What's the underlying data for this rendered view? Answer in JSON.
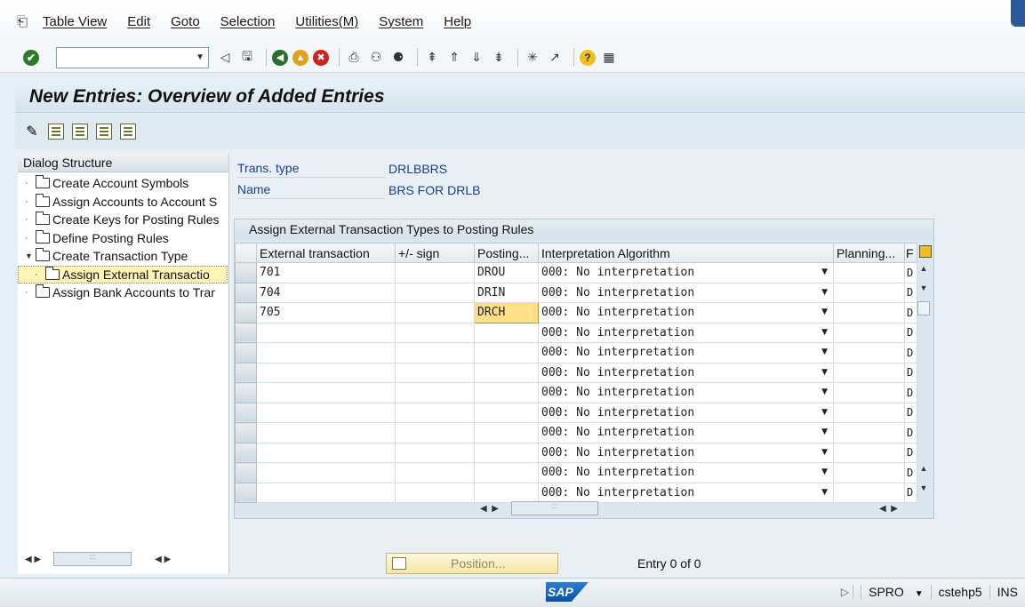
{
  "menubar": {
    "items": [
      "Table View",
      "Edit",
      "Goto",
      "Selection",
      "Utilities(M)",
      "System",
      "Help"
    ]
  },
  "toolbar": {
    "command_field_value": ""
  },
  "title": "New Entries: Overview of Added Entries",
  "dialog_structure": {
    "header": "Dialog Structure",
    "items": [
      {
        "label": "Create Account Symbols",
        "level": 0,
        "expanded": false
      },
      {
        "label": "Assign Accounts to Account S",
        "level": 0,
        "expanded": false
      },
      {
        "label": "Create Keys for Posting Rules",
        "level": 0,
        "expanded": false
      },
      {
        "label": "Define Posting Rules",
        "level": 0,
        "expanded": false
      },
      {
        "label": "Create Transaction Type",
        "level": 0,
        "expanded": true
      },
      {
        "label": "Assign External Transactio",
        "level": 1,
        "selected": true
      },
      {
        "label": "Assign Bank Accounts to Trar",
        "level": 0,
        "expanded": false
      }
    ]
  },
  "header_fields": [
    {
      "label": "Trans. type",
      "value": "DRLBBRS"
    },
    {
      "label": "Name",
      "value": "BRS FOR DRLB"
    }
  ],
  "table": {
    "title": "Assign External Transaction Types to Posting Rules",
    "columns": [
      "External transaction",
      "+/- sign",
      "Posting...",
      "Interpretation Algorithm",
      "Planning...",
      "F"
    ],
    "rows": [
      {
        "ext": "701",
        "sign": "",
        "posting": "DROU",
        "algo": "000: No interpretation",
        "planning": "",
        "last": "D"
      },
      {
        "ext": "704",
        "sign": "",
        "posting": "DRIN",
        "algo": "000: No interpretation",
        "planning": "",
        "last": "D"
      },
      {
        "ext": "705",
        "sign": "",
        "posting": "DRCH",
        "algo": "000: No interpretation",
        "planning": "",
        "last": "D"
      },
      {
        "ext": "",
        "sign": "",
        "posting": "",
        "algo": "000: No interpretation",
        "planning": "",
        "last": "D"
      },
      {
        "ext": "",
        "sign": "",
        "posting": "",
        "algo": "000: No interpretation",
        "planning": "",
        "last": "D"
      },
      {
        "ext": "",
        "sign": "",
        "posting": "",
        "algo": "000: No interpretation",
        "planning": "",
        "last": "D"
      },
      {
        "ext": "",
        "sign": "",
        "posting": "",
        "algo": "000: No interpretation",
        "planning": "",
        "last": "D"
      },
      {
        "ext": "",
        "sign": "",
        "posting": "",
        "algo": "000: No interpretation",
        "planning": "",
        "last": "D"
      },
      {
        "ext": "",
        "sign": "",
        "posting": "",
        "algo": "000: No interpretation",
        "planning": "",
        "last": "D"
      },
      {
        "ext": "",
        "sign": "",
        "posting": "",
        "algo": "000: No interpretation",
        "planning": "",
        "last": "D"
      },
      {
        "ext": "",
        "sign": "",
        "posting": "",
        "algo": "000: No interpretation",
        "planning": "",
        "last": "D"
      },
      {
        "ext": "",
        "sign": "",
        "posting": "",
        "algo": "000: No interpretation",
        "planning": "",
        "last": "D"
      }
    ]
  },
  "position_button": "Position...",
  "entry_text": "Entry 0 of 0",
  "status": {
    "logo": "SAP",
    "transaction": "SPRO",
    "server": "cstehp5",
    "mode": "INS"
  }
}
